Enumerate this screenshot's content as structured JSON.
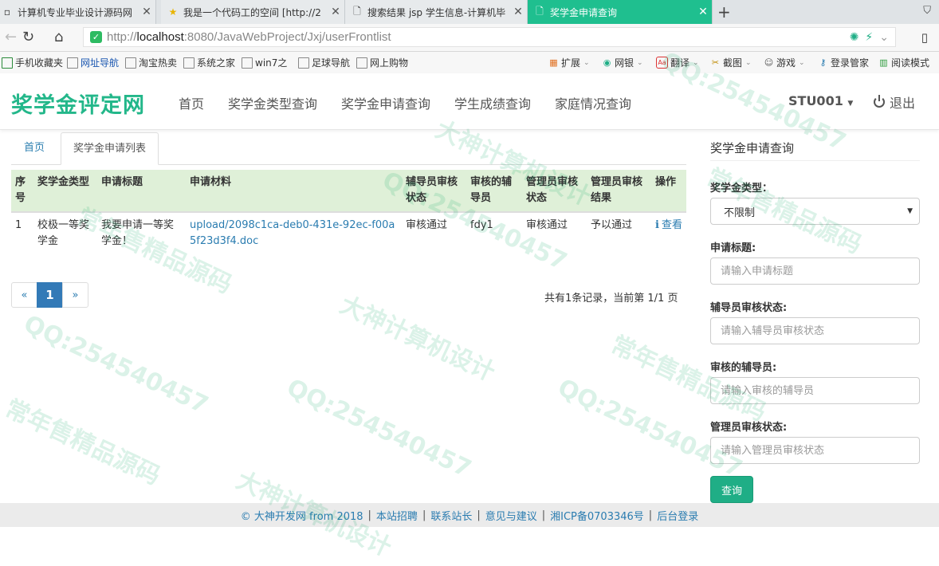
{
  "browser": {
    "tabs": [
      {
        "title": "计算机专业毕业设计源码网",
        "icon": "page-icon",
        "active": false
      },
      {
        "title": "我是一个代码工的空间 [http://2",
        "icon": "star-icon",
        "active": false
      },
      {
        "title": "搜索结果 jsp 学生信息-计算机毕",
        "icon": "document-icon",
        "active": false
      },
      {
        "title": "奖学金申请查询",
        "icon": "document-icon",
        "active": true
      }
    ],
    "address": {
      "prefix": "http://",
      "host": "localhost",
      "rest": ":8080/JavaWebProject/Jxj/userFrontlist"
    },
    "bookmarks_left": [
      "手机收藏夹",
      "网址导航",
      "淘宝热卖",
      "系统之家",
      "win7之",
      "足球导航",
      "网上购物"
    ],
    "bookmarks_right": [
      "扩展",
      "网银",
      "翻译",
      "截图",
      "游戏",
      "登录管家",
      "阅读模式"
    ]
  },
  "site": {
    "brand": "奖学金评定网",
    "nav": [
      "首页",
      "奖学金类型查询",
      "奖学金申请查询",
      "学生成绩查询",
      "家庭情况查询"
    ],
    "user": "STU001",
    "logout": "退出"
  },
  "tabs": {
    "home": "首页",
    "current": "奖学金申请列表"
  },
  "table": {
    "headers": [
      "序号",
      "奖学金类型",
      "申请标题",
      "申请材料",
      "辅导员审核状态",
      "审核的辅导员",
      "管理员审核状态",
      "管理员审核结果",
      "操作"
    ],
    "rows": [
      {
        "index": "1",
        "type": "校极一等奖学金",
        "title": "我要申请一等奖学金！",
        "material": "upload/2098c1ca-deb0-431e-92ec-f00a5f23d3f4.doc",
        "counselor_status": "审核通过",
        "counselor": "fdy1",
        "admin_status": "审核通过",
        "admin_result": "予以通过",
        "action": "查看"
      }
    ]
  },
  "pagination": {
    "prev": "«",
    "current": "1",
    "next": "»",
    "info": "共有1条记录，当前第 1/1 页"
  },
  "search": {
    "title": "奖学金申请查询",
    "type_label": "奖学金类型：",
    "type_value": "不限制",
    "title_label": "申请标题:",
    "title_placeholder": "请输入申请标题",
    "counselor_status_label": "辅导员审核状态:",
    "counselor_status_placeholder": "请输入辅导员审核状态",
    "counselor_label": "审核的辅导员:",
    "counselor_placeholder": "请输入审核的辅导员",
    "admin_status_label": "管理员审核状态:",
    "admin_status_placeholder": "请输入管理员审核状态",
    "button": "查询"
  },
  "footer": {
    "copyright": "© 大神开发网 from 2018",
    "links": [
      "本站招聘",
      "联系站长",
      "意见与建议",
      "湘ICP备0703346号",
      "后台登录"
    ]
  },
  "watermarks": [
    "QQ:254540457",
    "大神计算机设计",
    "常年售精品源码"
  ],
  "colors": {
    "brand": "#23b78a",
    "active_tab": "#1fbf8f",
    "table_header": "#dff0d8",
    "link": "#2a7cb0",
    "button": "#1fae86"
  }
}
